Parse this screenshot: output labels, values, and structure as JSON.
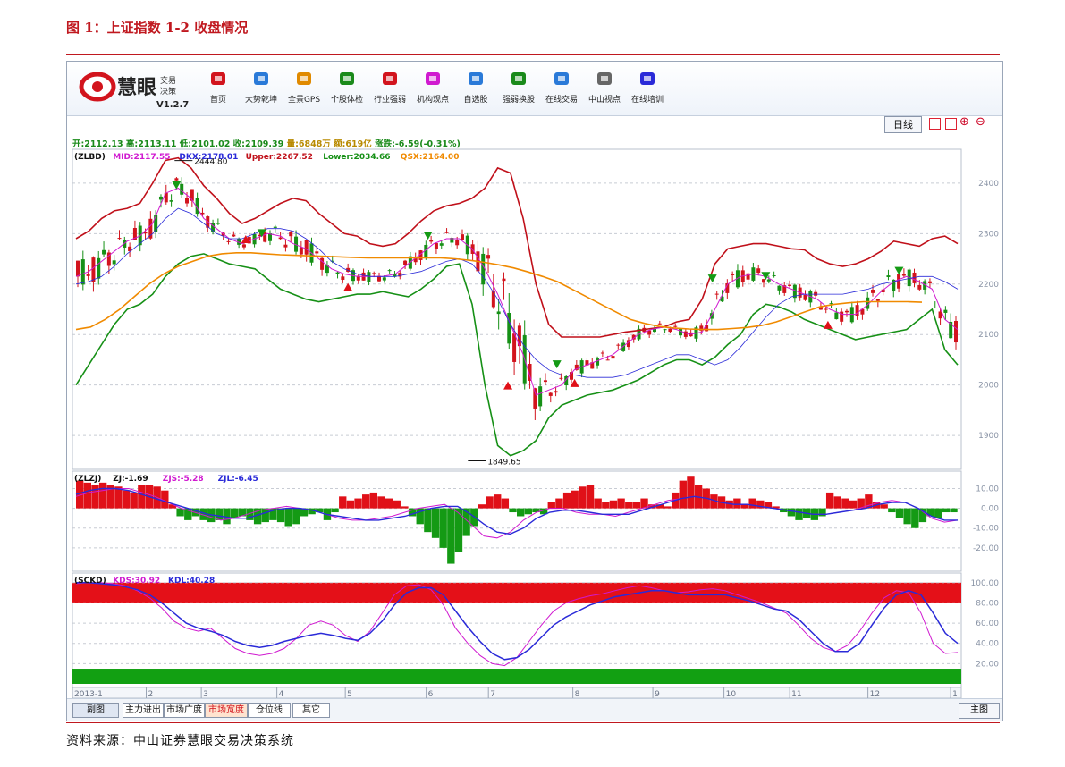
{
  "figure_title": "图 1：上证指数 1-2 收盘情况",
  "source_note": "资料来源：中山证券慧眼交易决策系统",
  "app": {
    "logo_text": "慧眼",
    "logo_sub1": "交易",
    "logo_sub2": "决策",
    "version": "V1.2.7",
    "toolbar": [
      {
        "label": "首页",
        "icon": "home-icon"
      },
      {
        "label": "大势乾坤",
        "icon": "magnifier-doc-icon"
      },
      {
        "label": "全景GPS",
        "icon": "grid-icon"
      },
      {
        "label": "个股体检",
        "icon": "checkup-icon"
      },
      {
        "label": "行业强弱",
        "icon": "bar-icon"
      },
      {
        "label": "机构观点",
        "icon": "people-icon"
      },
      {
        "label": "自选股",
        "icon": "box-icon"
      },
      {
        "label": "强弱换股",
        "icon": "refresh-icon"
      },
      {
        "label": "在线交易",
        "icon": "cart-icon"
      },
      {
        "label": "中山视点",
        "icon": "doc-icon"
      },
      {
        "label": "在线培训",
        "icon": "monitor-icon"
      }
    ],
    "period_button": "日线",
    "ohlc_line": [
      {
        "text": "开:2112.13",
        "color": "#1a8a1a"
      },
      {
        "text": "高:2113.11",
        "color": "#1a8a1a"
      },
      {
        "text": "低:2101.02",
        "color": "#1a8a1a"
      },
      {
        "text": "收:2109.39",
        "color": "#1a8a1a"
      },
      {
        "text": "量:6848万",
        "color": "#b88a00"
      },
      {
        "text": "额:619亿",
        "color": "#b88a00"
      },
      {
        "text": "涨跌:-6.59(-0.31%)",
        "color": "#1a8a1a"
      }
    ],
    "bottom_tabs": [
      "副图",
      "主力进出",
      "市场广度",
      "市场宽度",
      "仓位线",
      "其它"
    ],
    "main_button": "主图"
  },
  "chart_data": [
    {
      "type": "candlestick",
      "panel": "ZLBD",
      "indicator_labels": [
        {
          "text": "(ZLBD)",
          "color": "#111111"
        },
        {
          "text": "MID:2117.55",
          "color": "#d01ad0"
        },
        {
          "text": "DKX:2178.01",
          "color": "#2a2ad8"
        },
        {
          "text": "Upper:2267.52",
          "color": "#c0101a"
        },
        {
          "text": "Lower:2034.66",
          "color": "#169016"
        },
        {
          "text": "QSX:2164.00",
          "color": "#f08a00"
        }
      ],
      "annotations": [
        {
          "text": "2444.80",
          "x": 0.115,
          "y": 2444.8
        },
        {
          "text": "1849.65",
          "x": 0.445,
          "y": 1849.65
        }
      ],
      "y_ticks": [
        "2400",
        "2300",
        "2200",
        "2100",
        "2000",
        "1900"
      ],
      "ylim": [
        1840,
        2460
      ],
      "upper": [
        2290,
        2305,
        2330,
        2345,
        2350,
        2360,
        2400,
        2445,
        2450,
        2430,
        2395,
        2370,
        2340,
        2320,
        2330,
        2345,
        2360,
        2370,
        2365,
        2340,
        2320,
        2300,
        2295,
        2280,
        2275,
        2280,
        2300,
        2325,
        2345,
        2355,
        2360,
        2370,
        2390,
        2430,
        2420,
        2330,
        2200,
        2120,
        2095,
        2095,
        2095,
        2095,
        2100,
        2105,
        2108,
        2112,
        2115,
        2125,
        2130,
        2170,
        2240,
        2270,
        2275,
        2280,
        2280,
        2275,
        2270,
        2268,
        2250,
        2240,
        2235,
        2240,
        2250,
        2265,
        2285,
        2280,
        2275,
        2290,
        2295,
        2280
      ],
      "mid": [
        2215,
        2225,
        2245,
        2265,
        2285,
        2295,
        2320,
        2380,
        2390,
        2370,
        2330,
        2310,
        2290,
        2280,
        2290,
        2300,
        2295,
        2280,
        2270,
        2250,
        2230,
        2220,
        2215,
        2215,
        2215,
        2220,
        2240,
        2260,
        2280,
        2290,
        2290,
        2270,
        2230,
        2180,
        2120,
        2060,
        1980,
        1990,
        2000,
        2030,
        2040,
        2050,
        2060,
        2080,
        2100,
        2110,
        2115,
        2110,
        2100,
        2105,
        2150,
        2200,
        2215,
        2220,
        2215,
        2200,
        2190,
        2180,
        2170,
        2150,
        2140,
        2140,
        2160,
        2185,
        2205,
        2215,
        2205,
        2190,
        2130,
        2110
      ],
      "lower": [
        2000,
        2040,
        2080,
        2120,
        2150,
        2160,
        2180,
        2215,
        2240,
        2255,
        2260,
        2250,
        2240,
        2235,
        2230,
        2210,
        2190,
        2180,
        2170,
        2165,
        2170,
        2175,
        2180,
        2180,
        2185,
        2180,
        2175,
        2190,
        2210,
        2235,
        2240,
        2160,
        2000,
        1880,
        1860,
        1870,
        1890,
        1935,
        1960,
        1970,
        1980,
        1985,
        1990,
        2000,
        2010,
        2025,
        2040,
        2050,
        2050,
        2040,
        2055,
        2080,
        2100,
        2140,
        2160,
        2155,
        2145,
        2130,
        2120,
        2110,
        2100,
        2090,
        2095,
        2100,
        2105,
        2110,
        2130,
        2150,
        2070,
        2040
      ],
      "dkx": [
        2200,
        2205,
        2215,
        2235,
        2260,
        2280,
        2300,
        2330,
        2350,
        2340,
        2320,
        2300,
        2290,
        2290,
        2300,
        2310,
        2310,
        2305,
        2290,
        2270,
        2245,
        2230,
        2220,
        2215,
        2215,
        2215,
        2220,
        2225,
        2235,
        2245,
        2250,
        2240,
        2210,
        2170,
        2120,
        2080,
        2050,
        2030,
        2020,
        2020,
        2015,
        2015,
        2015,
        2020,
        2030,
        2040,
        2050,
        2060,
        2060,
        2050,
        2040,
        2050,
        2075,
        2105,
        2135,
        2160,
        2175,
        2180,
        2180,
        2180,
        2180,
        2185,
        2190,
        2200,
        2205,
        2210,
        2215,
        2215,
        2205,
        2190
      ],
      "qsx": [
        2110,
        2115,
        2130,
        2150,
        2175,
        2200,
        2220,
        2235,
        2245,
        2255,
        2260,
        2262,
        2262,
        2260,
        2258,
        2257,
        2256,
        2255,
        2254,
        2253,
        2252,
        2252,
        2252,
        2252,
        2252,
        2252,
        2250,
        2247,
        2243,
        2238,
        2232,
        2224,
        2215,
        2205,
        2190,
        2175,
        2160,
        2145,
        2130,
        2122,
        2116,
        2113,
        2111,
        2110,
        2110,
        2112,
        2114,
        2118,
        2125,
        2135,
        2145,
        2155,
        2160,
        2163,
        2165,
        2165,
        2165,
        2165,
        2164
      ]
    },
    {
      "type": "bar",
      "panel": "ZLZJ",
      "indicator_labels": [
        {
          "text": "(ZLZJ)",
          "color": "#111111"
        },
        {
          "text": "ZJ:-1.69",
          "color": "#111111"
        },
        {
          "text": "ZJS:-5.28",
          "color": "#d01ad0"
        },
        {
          "text": "ZJL:-6.45",
          "color": "#2a2ad8"
        }
      ],
      "y_ticks": [
        "10.00",
        "0.00",
        "-10.00",
        "-20.00"
      ],
      "ylim": [
        -30,
        17
      ],
      "values": [
        14,
        13,
        12,
        13,
        12,
        11,
        9,
        8,
        12,
        12,
        11,
        9,
        2,
        -4,
        -6,
        -4,
        -6,
        -7,
        -6,
        -8,
        -5,
        -4,
        -6,
        -8,
        -7,
        -6,
        -7,
        -9,
        -8,
        -4,
        -3,
        -2,
        -6,
        -2,
        6,
        4,
        5,
        7,
        8,
        6,
        5,
        4,
        1,
        -4,
        -8,
        -12,
        -15,
        -20,
        -28,
        -22,
        -14,
        -9,
        2,
        6,
        7,
        5,
        -2,
        -4,
        -3,
        -2,
        -3,
        3,
        5,
        8,
        9,
        11,
        12,
        5,
        3,
        4,
        5,
        3,
        3,
        5,
        2,
        2,
        1,
        8,
        14,
        16,
        12,
        10,
        7,
        6,
        4,
        5,
        2,
        5,
        4,
        3,
        1,
        -2,
        -4,
        -6,
        -5,
        -6,
        -4,
        8,
        6,
        5,
        4,
        5,
        7,
        3,
        2,
        -2,
        -5,
        -8,
        -10,
        -7,
        -4,
        -5,
        -2,
        -2
      ],
      "line_zjs": [
        6,
        8,
        9,
        10,
        10,
        8,
        6,
        3,
        0,
        -2,
        -4,
        -6,
        -5,
        -3,
        -1,
        0,
        1,
        0,
        -1,
        -3,
        -5,
        -6,
        -6,
        -5,
        -4,
        -2,
        0,
        1,
        2,
        -2,
        -8,
        -14,
        -15,
        -12,
        -6,
        -2,
        0,
        0,
        -2,
        -3,
        -3,
        -4,
        -2,
        0,
        2,
        4,
        5,
        6,
        5,
        3,
        2,
        2,
        1,
        0,
        -1,
        -2,
        -3,
        -3,
        -2,
        -1,
        1,
        3,
        4,
        3,
        0,
        -5,
        -7,
        -6
      ],
      "line_zjl": [
        7,
        9,
        10,
        10,
        9,
        7,
        5,
        3,
        1,
        -1,
        -3,
        -4,
        -5,
        -5,
        -3,
        -1,
        0,
        0,
        -1,
        -3,
        -4,
        -5,
        -6,
        -6,
        -5,
        -4,
        -2,
        0,
        1,
        1,
        -3,
        -8,
        -12,
        -13,
        -10,
        -5,
        -2,
        -1,
        -1,
        -2,
        -3,
        -3,
        -3,
        -1,
        1,
        3,
        5,
        6,
        5,
        3,
        2,
        2,
        1,
        0,
        -1,
        -2,
        -3,
        -3,
        -2,
        -1,
        0,
        2,
        3,
        3,
        0,
        -4,
        -6,
        -6
      ]
    },
    {
      "type": "line",
      "panel": "SCKD",
      "indicator_labels": [
        {
          "text": "(SCKD)",
          "color": "#111111"
        },
        {
          "text": "KDS:30.92",
          "color": "#d01ad0"
        },
        {
          "text": "KDL:40.28",
          "color": "#2a2ad8"
        }
      ],
      "y_ticks": [
        "100.00",
        "80.00",
        "60.00",
        "40.00",
        "20.00"
      ],
      "ylim": [
        0,
        106
      ],
      "band_high": [
        80,
        100
      ],
      "band_low": [
        0,
        15
      ],
      "kds": [
        99,
        100,
        100,
        99,
        97,
        92,
        85,
        75,
        62,
        55,
        52,
        55,
        45,
        35,
        30,
        28,
        30,
        35,
        45,
        58,
        62,
        58,
        48,
        42,
        52,
        70,
        88,
        97,
        98,
        93,
        78,
        55,
        40,
        28,
        20,
        18,
        26,
        42,
        58,
        72,
        80,
        84,
        87,
        89,
        92,
        95,
        97,
        95,
        92,
        90,
        91,
        93,
        94,
        92,
        88,
        84,
        80,
        75,
        70,
        58,
        45,
        36,
        32,
        38,
        52,
        70,
        85,
        92,
        90,
        70,
        40,
        30,
        31
      ],
      "kdl": [
        100,
        100,
        99,
        98,
        96,
        93,
        88,
        80,
        70,
        60,
        55,
        52,
        48,
        42,
        38,
        36,
        38,
        42,
        45,
        48,
        50,
        48,
        45,
        43,
        50,
        62,
        78,
        90,
        95,
        95,
        88,
        72,
        56,
        42,
        30,
        24,
        26,
        34,
        46,
        58,
        66,
        72,
        78,
        82,
        86,
        88,
        90,
        92,
        92,
        90,
        88,
        88,
        88,
        88,
        85,
        82,
        78,
        74,
        72,
        64,
        52,
        40,
        32,
        32,
        40,
        58,
        75,
        88,
        92,
        88,
        70,
        50,
        40
      ],
      "x_ticks": [
        "2013-1",
        "2",
        "3",
        "4",
        "5",
        "6",
        "7",
        "8",
        "9",
        "10",
        "11",
        "12",
        "1"
      ]
    }
  ]
}
